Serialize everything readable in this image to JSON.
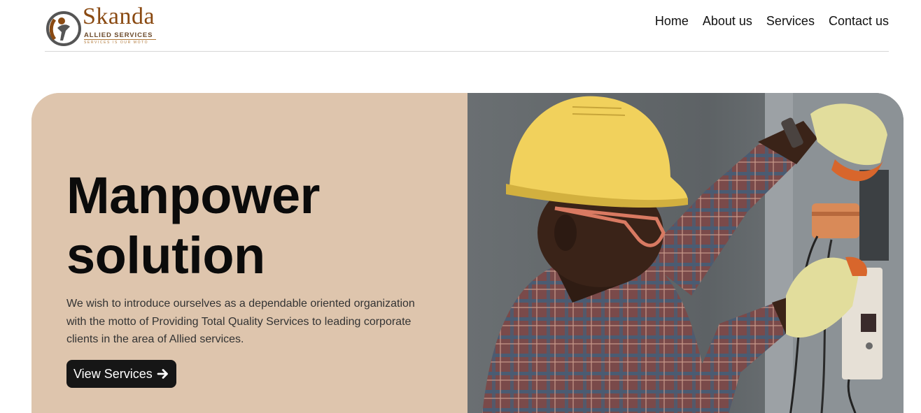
{
  "logo": {
    "brand": "Skanda",
    "subtitle": "ALLIED SERVICES",
    "tagline": "SERVICES IS OUR MOTO",
    "colors": {
      "primary": "#8a4a12",
      "secondary": "#555555"
    }
  },
  "nav": {
    "items": [
      "Home",
      "About us",
      "Services",
      "Contact us"
    ]
  },
  "hero": {
    "title_line1": "Manpower",
    "title_line2": "solution",
    "description": "We wish to introduce ourselves as a dependable oriented organization with the motto of Providing Total Quality Services to leading corporate clients in the area of Allied services.",
    "button_label": "View Services",
    "button_icon": "arrow-right-icon",
    "image_subject": "electrician-photo",
    "colors": {
      "panel": "#dec5ad",
      "button": "#161616",
      "helmet": "#f1d15c"
    }
  }
}
